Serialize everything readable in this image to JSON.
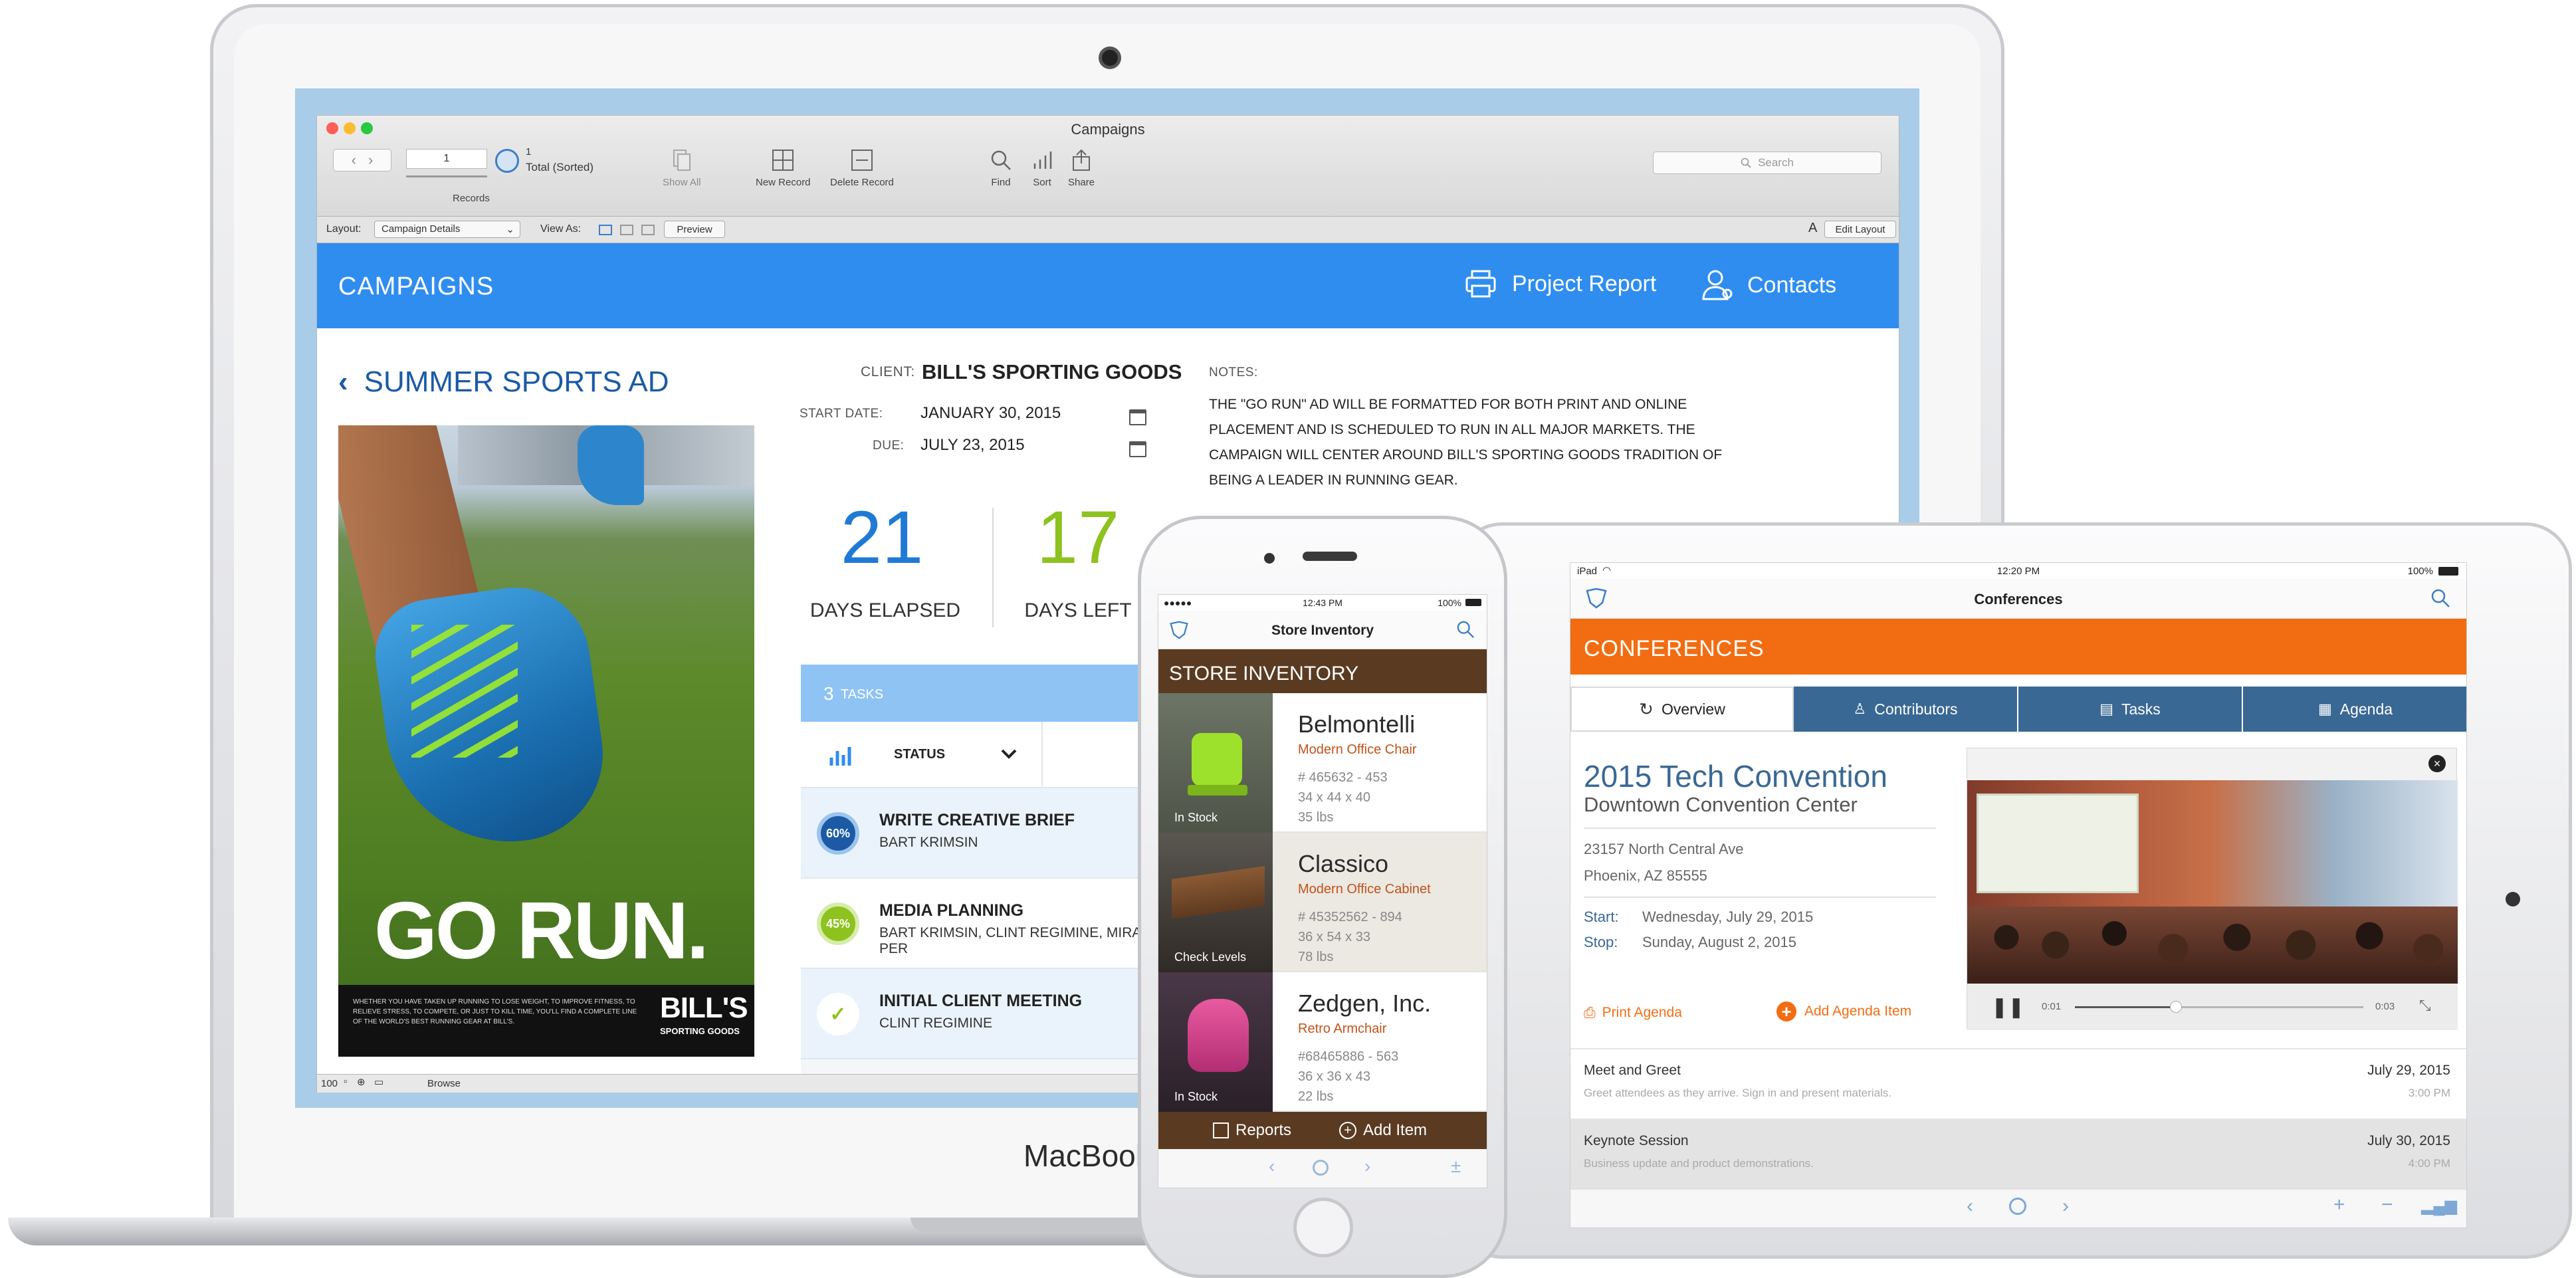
{
  "macbook": {
    "brand": "MacBook",
    "window_title": "Campaigns",
    "toolbar": {
      "record_value": "1",
      "record_total": "1",
      "record_total_label": "Total (Sorted)",
      "records_label": "Records",
      "show_all": "Show All",
      "new_record": "New Record",
      "delete_record": "Delete Record",
      "find": "Find",
      "sort": "Sort",
      "share": "Share",
      "search_placeholder": "Search"
    },
    "layoutbar": {
      "layout_label": "Layout:",
      "layout_value": "Campaign Details",
      "view_as": "View As:",
      "preview": "Preview",
      "font_size_glyph": "A",
      "edit_layout": "Edit Layout"
    },
    "header": {
      "title": "CAMPAIGNS",
      "project_report": "Project Report",
      "contacts": "Contacts"
    },
    "record": {
      "campaign_title": "SUMMER SPORTS AD",
      "client_label": "CLIENT:",
      "client": "BILL'S SPORTING GOODS",
      "start_label": "START DATE:",
      "start_date": "JANUARY 30, 2015",
      "due_label": "DUE:",
      "due_date": "JULY 23, 2015",
      "notes_label": "NOTES:",
      "notes": "THE \"GO RUN\" AD WILL BE FORMATTED FOR BOTH PRINT AND ONLINE PLACEMENT AND IS SCHEDULED TO RUN IN ALL MAJOR  MARKETS. THE CAMPAIGN WILL CENTER AROUND BILL'S SPORTING GOODS TRADITION OF BEING A LEADER IN RUNNING GEAR.",
      "days_elapsed": "21",
      "days_elapsed_label": "DAYS ELAPSED",
      "days_left": "17",
      "days_left_label": "DAYS LEFT",
      "tasks_count": "3",
      "tasks_label": "TASKS",
      "status_label": "STATUS",
      "tasks": [
        {
          "pct": "60%",
          "title": "WRITE CREATIVE BRIEF",
          "people": "BART KRIMSIN"
        },
        {
          "pct": "45%",
          "title": "MEDIA PLANNING",
          "people": "BART KRIMSIN, CLINT REGIMINE, MIRA PER"
        },
        {
          "pct": "",
          "title": "INITIAL CLIENT MEETING",
          "people": "CLINT REGIMINE"
        }
      ]
    },
    "ad": {
      "headline": "GO RUN.",
      "fine_print": "WHETHER YOU HAVE TAKEN UP RUNNING TO LOSE WEIGHT, TO IMPROVE FITNESS, TO RELIEVE STRESS, TO COMPETE, OR JUST TO KILL TIME, YOU'LL FIND A COMPLETE LINE OF THE WORLD'S BEST RUNNING GEAR AT BILL'S.",
      "brand": "BILL'S",
      "brand_sub": "SPORTING GOODS"
    },
    "statusbar": {
      "zoom": "100",
      "mode": "Browse"
    }
  },
  "iphone": {
    "carrier": "●●●●● ",
    "time": "12:43 PM",
    "battery": "100%",
    "nav_title": "Store Inventory",
    "header": "STORE INVENTORY",
    "products": [
      {
        "name": "Belmontelli",
        "type": "Modern Office Chair",
        "sku": "# 465632 - 453",
        "dims": "34 x 44 x 40",
        "weight": "35 lbs",
        "badge": "In Stock"
      },
      {
        "name": "Classico",
        "type": "Modern Office Cabinet",
        "sku": "# 45352562 - 894",
        "dims": "36 x 54 x 33",
        "weight": "78 lbs",
        "badge": "Check Levels"
      },
      {
        "name": "Zedgen, Inc.",
        "type": "Retro Armchair",
        "sku": "#68465886 - 563",
        "dims": "36 x 36 x 43",
        "weight": "22 lbs",
        "badge": "In Stock"
      }
    ],
    "reports": "Reports",
    "add_item": "Add Item",
    "plusminus": "±"
  },
  "ipad": {
    "device": "iPad",
    "time": "12:20 PM",
    "battery": "100%",
    "nav_title": "Conferences",
    "header": "CONFERENCES",
    "tabs": [
      "Overview",
      "Contributors",
      "Tasks",
      "Agenda"
    ],
    "event_title": "2015 Tech Convention",
    "venue": "Downtown Convention Center",
    "address1": "23157 North Central Ave",
    "address2": "Phoenix, AZ 85555",
    "start_label": "Start:",
    "start": "Wednesday, July 29, 2015",
    "stop_label": "Stop:",
    "stop": "Sunday, August 2, 2015",
    "print_agenda": "Print Agenda",
    "add_agenda": "Add Agenda Item",
    "video_elapsed": "0:01",
    "video_remaining": "0:03",
    "video_progress": 0.35,
    "agenda": [
      {
        "title": "Meet and Greet",
        "desc": "Greet attendees as they arrive. Sign in and present materials.",
        "date": "July 29, 2015",
        "time": "3:00 PM"
      },
      {
        "title": "Keynote Session",
        "desc": "Business update and product demonstrations.",
        "date": "July 30, 2015",
        "time": "4:00 PM"
      }
    ]
  },
  "colors": {
    "fm_blue": "#2f8df0",
    "orange": "#f26d12",
    "navy": "#3a6894",
    "brown": "#5a3b22",
    "green": "#8dc21f"
  }
}
